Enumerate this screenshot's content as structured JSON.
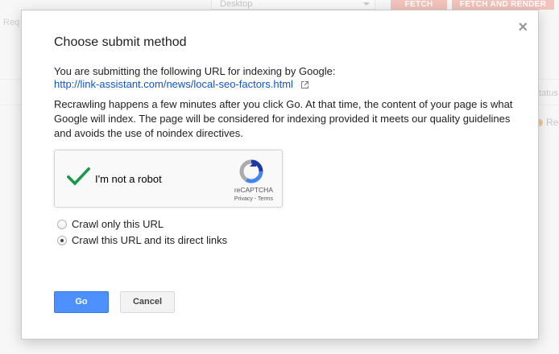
{
  "background": {
    "device_select": "Desktop",
    "fetch_button": "FETCH",
    "fetch_render_button": "FETCH AND RENDER",
    "request_label": "Req",
    "status_label": "tatus",
    "status_value": "Re"
  },
  "dialog": {
    "title": "Choose submit method",
    "close_glyph": "×",
    "intro": "You are submitting the following URL for indexing by Google:",
    "url": "http://link-assistant.com/news/local-seo-factors.html",
    "description": "Recrawling happens a few minutes after you click Go. At that time, the content of your page is what Google will index. The page will be considered for indexing provided it meets our quality guidelines and avoids the use of noindex directives.",
    "captcha": {
      "label": "I'm not a robot",
      "brand": "reCAPTCHA",
      "links": "Privacy - Terms",
      "checked": true
    },
    "options": [
      {
        "label": "Crawl only this URL",
        "selected": false
      },
      {
        "label": "Crawl this URL and its direct links",
        "selected": true
      }
    ],
    "go_label": "Go",
    "cancel_label": "Cancel"
  },
  "colors": {
    "primary_button": "#4d90fe",
    "link": "#1155cc",
    "check": "#159b48"
  }
}
